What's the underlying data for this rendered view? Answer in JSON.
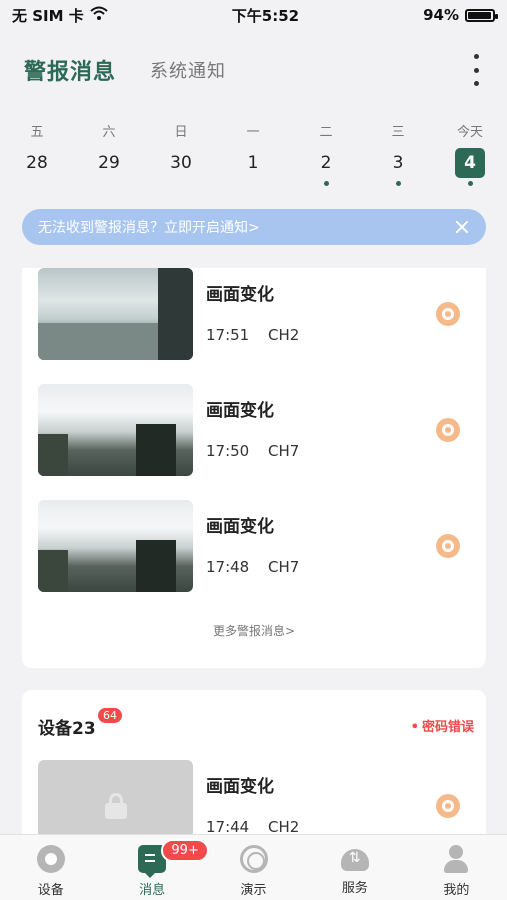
{
  "status_bar": {
    "carrier": "无 SIM 卡",
    "time": "下午5:52",
    "battery": "94%",
    "battery_level": 0.94
  },
  "header": {
    "tabs": [
      {
        "label": "警报消息",
        "active": true
      },
      {
        "label": "系统通知",
        "active": false
      }
    ]
  },
  "calendar": {
    "days": [
      {
        "weekday": "五",
        "date": "28",
        "has_alarm": false,
        "selected": false
      },
      {
        "weekday": "六",
        "date": "29",
        "has_alarm": false,
        "selected": false
      },
      {
        "weekday": "日",
        "date": "30",
        "has_alarm": false,
        "selected": false
      },
      {
        "weekday": "一",
        "date": "1",
        "has_alarm": false,
        "selected": false
      },
      {
        "weekday": "二",
        "date": "2",
        "has_alarm": true,
        "selected": false
      },
      {
        "weekday": "三",
        "date": "3",
        "has_alarm": true,
        "selected": false
      },
      {
        "weekday": "今天",
        "date": "4",
        "has_alarm": true,
        "selected": true
      }
    ]
  },
  "banner": {
    "text": "无法收到警报消息？立即开启通知>"
  },
  "alarm_list": {
    "items": [
      {
        "title": "画面变化",
        "time": "17:51",
        "channel": "CH2"
      },
      {
        "title": "画面变化",
        "time": "17:50",
        "channel": "CH7"
      },
      {
        "title": "画面变化",
        "time": "17:48",
        "channel": "CH7"
      }
    ],
    "more_label": "更多警报消息>"
  },
  "device_card": {
    "name": "设备23",
    "badge": "64",
    "status": "密码错误",
    "item": {
      "title": "画面变化",
      "time": "17:44",
      "channel": "CH2"
    }
  },
  "tabbar": {
    "items": [
      {
        "label": "设备",
        "icon": "device-icon"
      },
      {
        "label": "消息",
        "icon": "message-icon",
        "badge": "99+"
      },
      {
        "label": "演示",
        "icon": "demo-icon"
      },
      {
        "label": "服务",
        "icon": "service-icon"
      },
      {
        "label": "我的",
        "icon": "profile-icon"
      }
    ]
  },
  "colors": {
    "accent": "#2d6a55",
    "banner": "#a7c5ef",
    "alert": "#f04a4a",
    "alarm_icon": "#f6b98a"
  }
}
